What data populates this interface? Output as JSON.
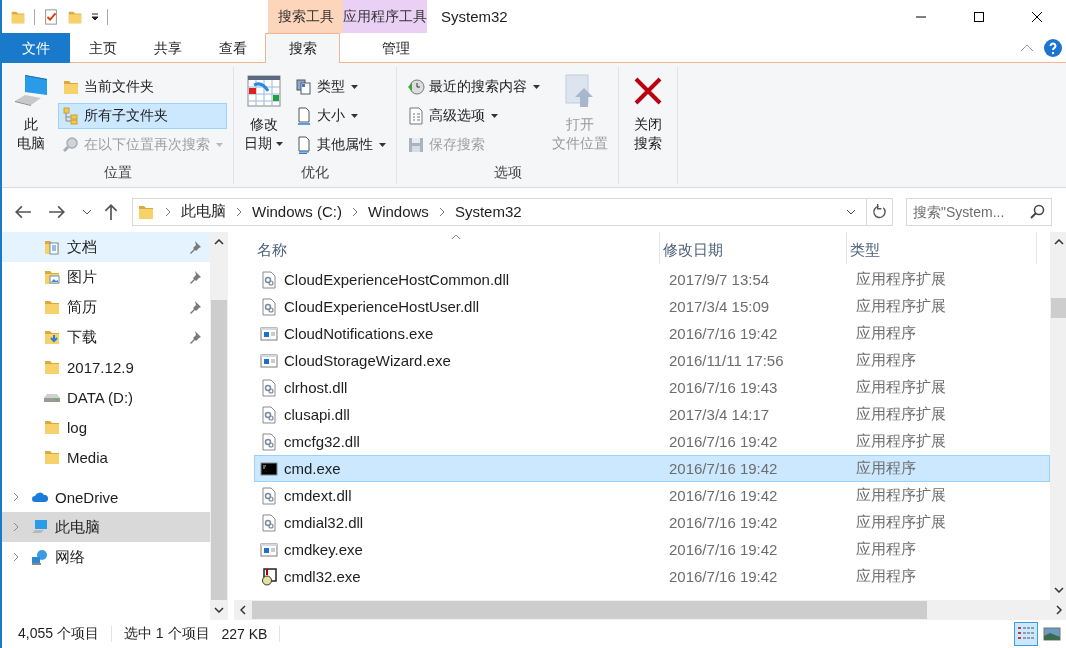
{
  "window": {
    "title": "System32"
  },
  "context_tabs": [
    {
      "label": "搜索工具",
      "color": "#fcd5ba"
    },
    {
      "label": "应用程序工具",
      "color": "#ebd0f5"
    }
  ],
  "ribbon_tabs": [
    {
      "label": "文件",
      "kind": "file",
      "selected": false
    },
    {
      "label": "主页",
      "kind": "tab",
      "selected": false
    },
    {
      "label": "共享",
      "kind": "tab",
      "selected": false
    },
    {
      "label": "查看",
      "kind": "tab",
      "selected": false
    },
    {
      "label": "搜索",
      "kind": "tab",
      "selected": true
    },
    {
      "label": "管理",
      "kind": "tab",
      "selected": false
    }
  ],
  "ribbon": {
    "groups": [
      {
        "label": "位置",
        "controls": [
          {
            "kind": "computer",
            "lines": [
              "此",
              "电脑"
            ],
            "dropdown": false,
            "disabled": false
          },
          {
            "kind": "stack",
            "items": [
              {
                "label": "当前文件夹",
                "kind": "current-folder",
                "dropdown": false,
                "disabled": false,
                "selected": false
              },
              {
                "label": "所有子文件夹",
                "kind": "subfolders",
                "dropdown": false,
                "disabled": false,
                "selected": true
              },
              {
                "label": "在以下位置再次搜索",
                "kind": "search-again",
                "dropdown": true,
                "disabled": true,
                "selected": false
              }
            ]
          }
        ]
      },
      {
        "label": "优化",
        "controls": [
          {
            "kind": "date-modified",
            "lines": [
              "修改",
              "日期"
            ],
            "dropdown": true,
            "disabled": false
          },
          {
            "kind": "stack",
            "items": [
              {
                "label": "类型",
                "kind": "type",
                "dropdown": true,
                "disabled": false,
                "selected": false
              },
              {
                "label": "大小",
                "kind": "size",
                "dropdown": true,
                "disabled": false,
                "selected": false
              },
              {
                "label": "其他属性",
                "kind": "other-properties",
                "dropdown": true,
                "disabled": false,
                "selected": false
              }
            ]
          }
        ]
      },
      {
        "label": "选项",
        "controls": [
          {
            "kind": "stack",
            "items": [
              {
                "label": "最近的搜索内容",
                "kind": "recent-searches",
                "dropdown": true,
                "disabled": false,
                "selected": false
              },
              {
                "label": "高级选项",
                "kind": "advanced",
                "dropdown": true,
                "disabled": false,
                "selected": false
              },
              {
                "label": "保存搜索",
                "kind": "save-search",
                "dropdown": false,
                "disabled": true,
                "selected": false
              }
            ]
          },
          {
            "kind": "open-location",
            "lines": [
              "打开",
              "文件位置"
            ],
            "dropdown": false,
            "disabled": true
          }
        ]
      },
      {
        "controls": [
          {
            "kind": "close-search",
            "lines": [
              "关闭",
              "搜索"
            ],
            "dropdown": false,
            "disabled": false
          }
        ]
      }
    ]
  },
  "address": {
    "crumbs": [
      "此电脑",
      "Windows (C:)",
      "Windows",
      "System32"
    ],
    "search_placeholder": "搜索\"System..."
  },
  "nav_pane": {
    "quick_access": [
      {
        "label": "文档",
        "kind": "documents",
        "pinned": true,
        "hovered": true
      },
      {
        "label": "图片",
        "kind": "pictures",
        "pinned": true,
        "hovered": false
      },
      {
        "label": "简历",
        "kind": "folder",
        "pinned": true,
        "hovered": false
      },
      {
        "label": "下载",
        "kind": "downloads",
        "pinned": true,
        "hovered": false
      },
      {
        "label": "2017.12.9",
        "kind": "folder",
        "pinned": false,
        "hovered": false
      },
      {
        "label": "DATA (D:)",
        "kind": "drive",
        "pinned": false,
        "hovered": false
      },
      {
        "label": "log",
        "kind": "folder",
        "pinned": false,
        "hovered": false
      },
      {
        "label": "Media",
        "kind": "folder",
        "pinned": false,
        "hovered": false
      }
    ],
    "roots": [
      {
        "label": "OneDrive",
        "kind": "cloud",
        "expanded": false,
        "selected": false
      },
      {
        "label": "此电脑",
        "kind": "computer",
        "expanded": false,
        "selected": true
      },
      {
        "label": "网络",
        "kind": "network",
        "expanded": false,
        "selected": false
      }
    ]
  },
  "file_list": {
    "columns": [
      "名称",
      "修改日期",
      "类型"
    ],
    "rows": [
      {
        "name": "CloudExperienceHostCommon.dll",
        "date": "2017/9/7 13:54",
        "type": "应用程序扩展",
        "kind": "dll",
        "selected": false
      },
      {
        "name": "CloudExperienceHostUser.dll",
        "date": "2017/3/4 15:09",
        "type": "应用程序扩展",
        "kind": "dll",
        "selected": false
      },
      {
        "name": "CloudNotifications.exe",
        "date": "2016/7/16 19:42",
        "type": "应用程序",
        "kind": "exe",
        "selected": false
      },
      {
        "name": "CloudStorageWizard.exe",
        "date": "2016/11/11 17:56",
        "type": "应用程序",
        "kind": "exe",
        "selected": false
      },
      {
        "name": "clrhost.dll",
        "date": "2016/7/16 19:43",
        "type": "应用程序扩展",
        "kind": "dll",
        "selected": false
      },
      {
        "name": "clusapi.dll",
        "date": "2017/3/4 14:17",
        "type": "应用程序扩展",
        "kind": "dll",
        "selected": false
      },
      {
        "name": "cmcfg32.dll",
        "date": "2016/7/16 19:42",
        "type": "应用程序扩展",
        "kind": "dll",
        "selected": false
      },
      {
        "name": "cmd.exe",
        "date": "2016/7/16 19:42",
        "type": "应用程序",
        "kind": "console",
        "selected": true
      },
      {
        "name": "cmdext.dll",
        "date": "2016/7/16 19:42",
        "type": "应用程序扩展",
        "kind": "dll",
        "selected": false
      },
      {
        "name": "cmdial32.dll",
        "date": "2016/7/16 19:42",
        "type": "应用程序扩展",
        "kind": "dll",
        "selected": false
      },
      {
        "name": "cmdkey.exe",
        "date": "2016/7/16 19:42",
        "type": "应用程序",
        "kind": "exe",
        "selected": false
      },
      {
        "name": "cmdl32.exe",
        "date": "2016/7/16 19:42",
        "type": "应用程序",
        "kind": "setup",
        "selected": false
      }
    ]
  },
  "status_bar": {
    "item_count": "4,055 个项目",
    "selection": "选中 1 个项目",
    "size": "227 KB",
    "views": [
      {
        "kind": "details",
        "selected": true
      },
      {
        "kind": "large-icons",
        "selected": false
      }
    ]
  }
}
